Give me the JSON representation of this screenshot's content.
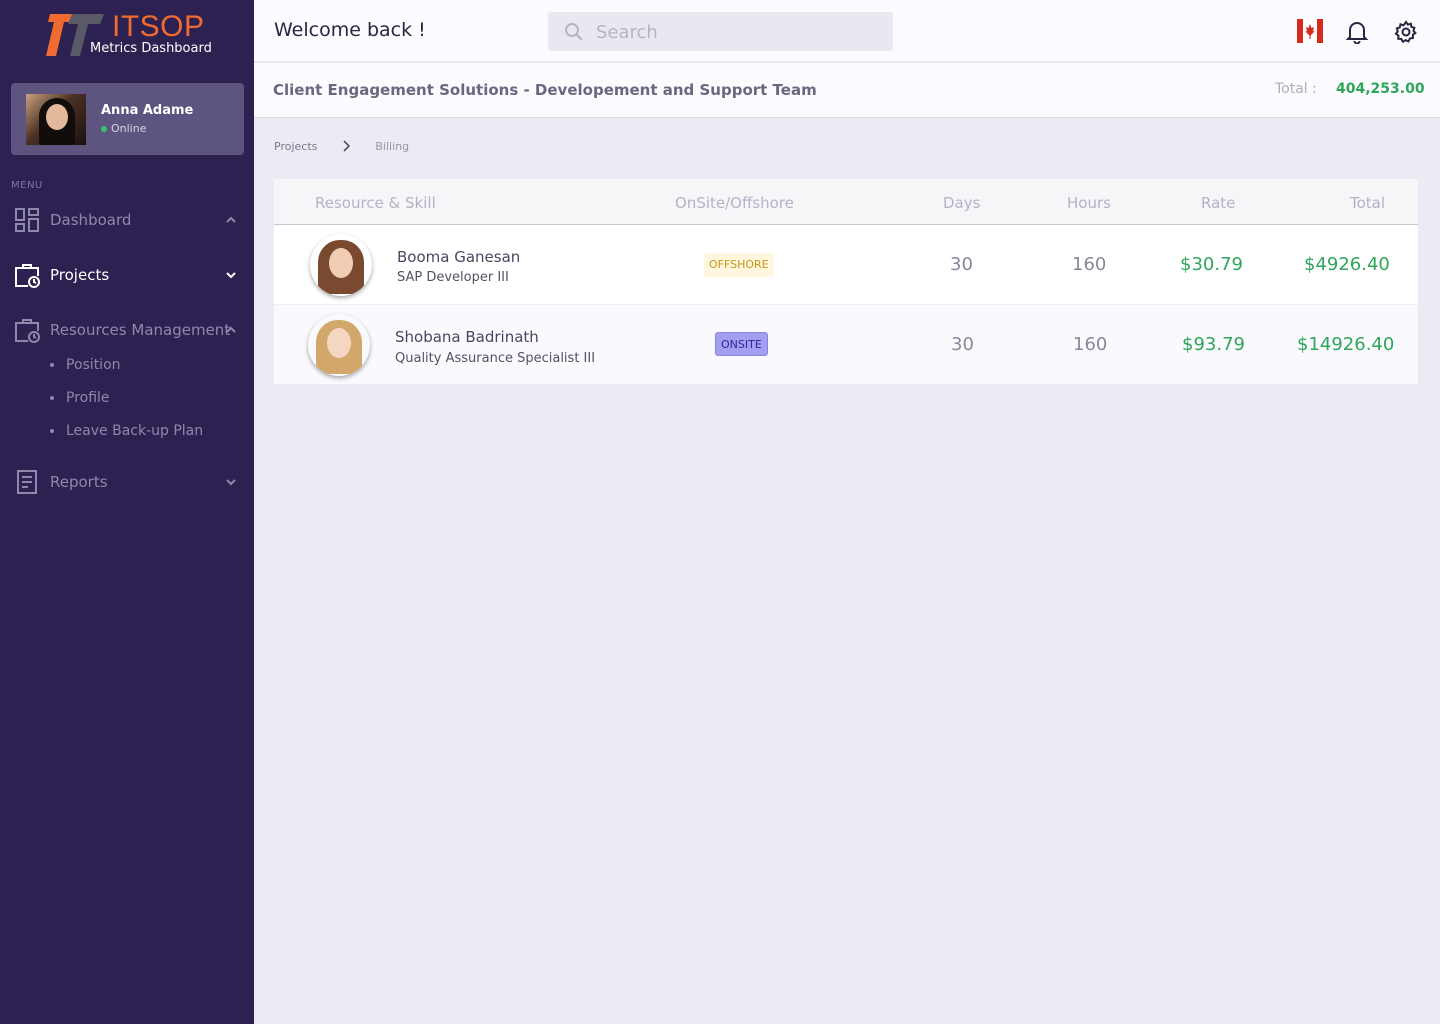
{
  "app": {
    "logo_title": "ITSOP",
    "logo_subtitle": "Metrics Dashboard"
  },
  "user": {
    "name": "Anna Adame",
    "status": "Online"
  },
  "sidebar": {
    "menu_label": "MENU",
    "items": [
      {
        "label": "Dashboard",
        "icon": "dashboard-grid-icon",
        "expanded": true
      },
      {
        "label": "Projects",
        "icon": "briefcase-clock-icon",
        "expanded": false,
        "active": true
      },
      {
        "label": "Resources Management",
        "icon": "briefcase-clock-icon",
        "expanded": true
      },
      {
        "label": "Reports",
        "icon": "document-icon",
        "expanded": false
      }
    ],
    "sub_items": [
      "Position",
      "Profile",
      "Leave Back-up Plan"
    ]
  },
  "header": {
    "welcome": "Welcome back !",
    "search_placeholder": "Search"
  },
  "team": {
    "title": "Client Engagement Solutions - Developement and Support Team",
    "total_label": "Total :",
    "total_value": "404,253.00"
  },
  "breadcrumb": {
    "items": [
      "Projects",
      "Billing"
    ]
  },
  "table": {
    "columns": [
      "Resource & Skill",
      "OnSite/Offshore",
      "Days",
      "Hours",
      "Rate",
      "Total"
    ],
    "rows": [
      {
        "name": "Booma Ganesan",
        "role": "SAP Developer III",
        "location": "OFFSHORE",
        "days": "30",
        "hours": "160",
        "rate": "$30.79",
        "total": "$4926.40"
      },
      {
        "name": "Shobana Badrinath",
        "role": "Quality Assurance Specialist III",
        "location": "ONSITE",
        "days": "30",
        "hours": "160",
        "rate": "$93.79",
        "total": "$14926.40"
      }
    ]
  },
  "colors": {
    "sidebar_bg": "#2c2150",
    "accent_orange": "#f06a32",
    "money_green": "#2fa55a"
  }
}
